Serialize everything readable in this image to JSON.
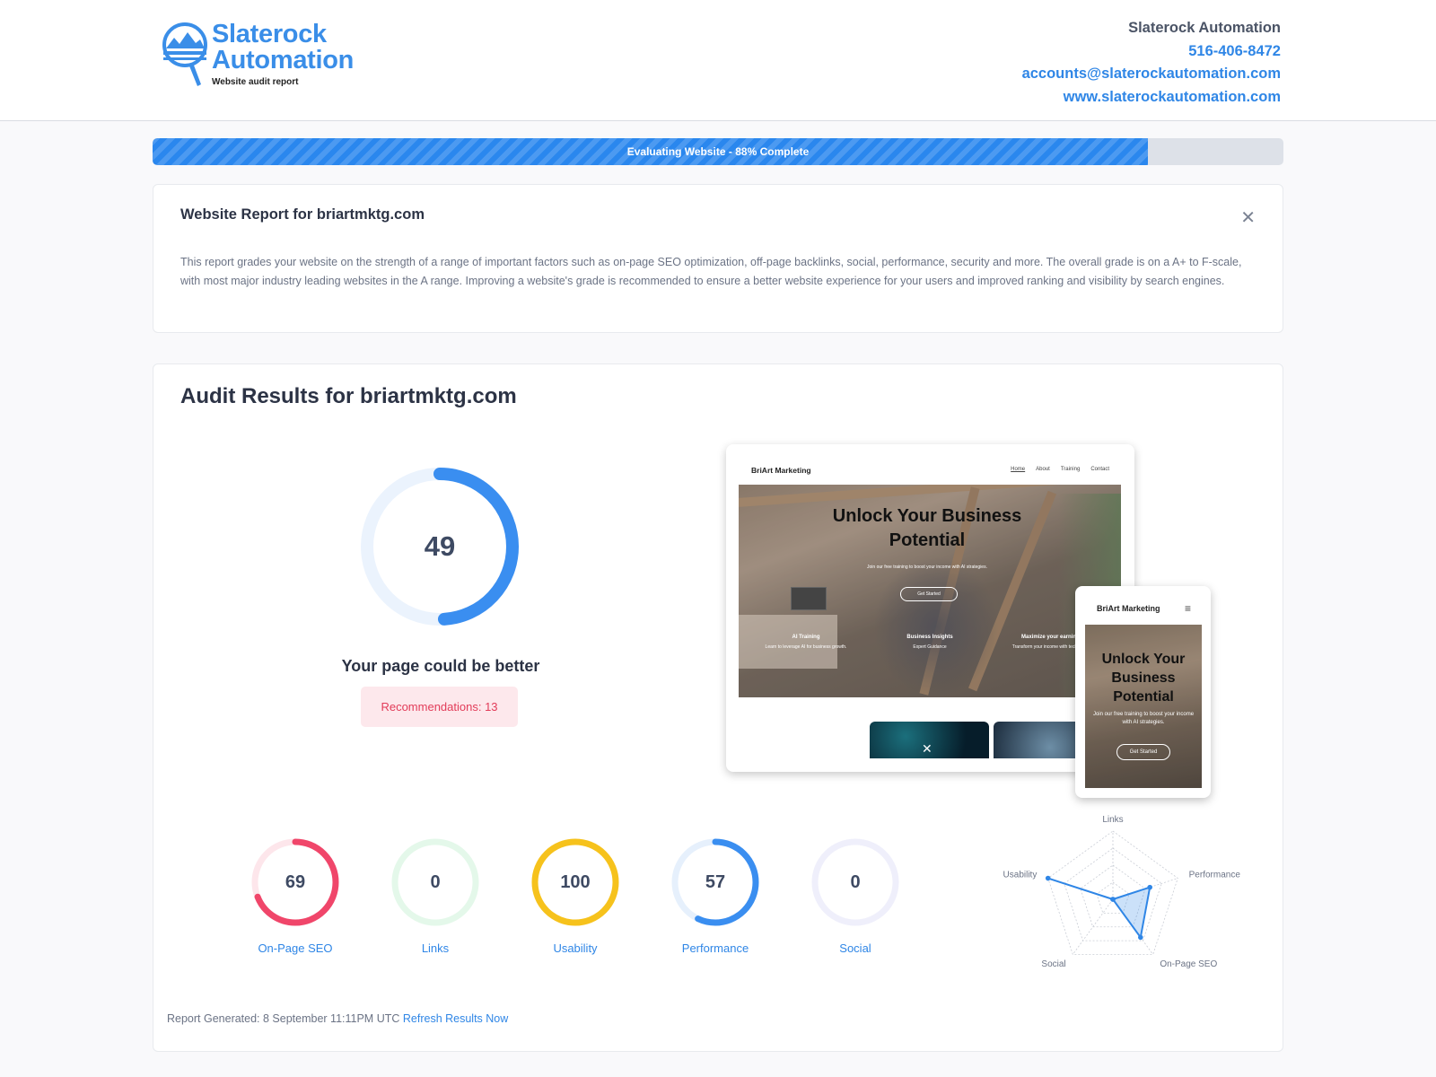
{
  "header": {
    "logo_line1": "Slaterock",
    "logo_line2": "Automation",
    "logo_sub": "Website audit report",
    "company": "Slaterock Automation",
    "phone": "516-406-8472",
    "email": "accounts@slaterockautomation.com",
    "website": "www.slaterockautomation.com"
  },
  "progress": {
    "label": "Evaluating Website - 88% Complete",
    "percent": 88
  },
  "intro": {
    "title": "Website Report for briartmktg.com",
    "close": "✕",
    "body": "This report grades your website on the strength of a range of important factors such as on-page SEO optimization, off-page backlinks, social, performance, security and more. The overall grade is on a A+ to F-scale, with most major industry leading websites in the A range. Improving a website's grade is recommended to ensure a better website experience for your users and improved ranking and visibility by search engines."
  },
  "audit": {
    "title": "Audit Results for briartmktg.com",
    "score": 49,
    "score_color": "#3a8ef0",
    "verdict": "Your page could be better",
    "recommendations": "Recommendations: 13"
  },
  "preview": {
    "brand": "BriArt Marketing",
    "nav": [
      "Home",
      "About",
      "Training",
      "Contact"
    ],
    "hero_title": "Unlock Your Business Potential",
    "hero_sub": "Join our free training to boost your income with AI strategies.",
    "hero_button": "Get Started",
    "features": [
      {
        "title": "AI Training",
        "text": "Learn to leverage AI for business growth."
      },
      {
        "title": "Business Insights",
        "text": "Expert Guidance"
      },
      {
        "title": "Maximize your earnings",
        "text": "Transform your income with techniques."
      }
    ],
    "phone_brand": "BriArt Marketing",
    "phone_menu": "≡",
    "phone_title": "Unlock Your Business Potential",
    "phone_sub": "Join our free training to boost your income with AI strategies.",
    "phone_button": "Get Started"
  },
  "categories": [
    {
      "label": "On-Page SEO",
      "score": 69,
      "color": "#f0466a",
      "track": "#fde6eb"
    },
    {
      "label": "Links",
      "score": 0,
      "color": "#2fc56a",
      "track": "#e4f8ea"
    },
    {
      "label": "Usability",
      "score": 100,
      "color": "#f6c21c",
      "track": "#fdf3d2"
    },
    {
      "label": "Performance",
      "score": 57,
      "color": "#3a8ef0",
      "track": "#e6f0fc"
    },
    {
      "label": "Social",
      "score": 0,
      "color": "#7a7fd8",
      "track": "#efeffb"
    }
  ],
  "chart_data": {
    "type": "radar",
    "axes": [
      "Links",
      "Performance",
      "On-Page SEO",
      "Social",
      "Usability"
    ],
    "values": [
      0,
      57,
      69,
      0,
      100
    ],
    "max": 100,
    "color": "#2f86e6"
  },
  "footer": {
    "generated": "Report Generated: 8 September 11:11PM UTC",
    "refresh": "Refresh Results Now"
  }
}
